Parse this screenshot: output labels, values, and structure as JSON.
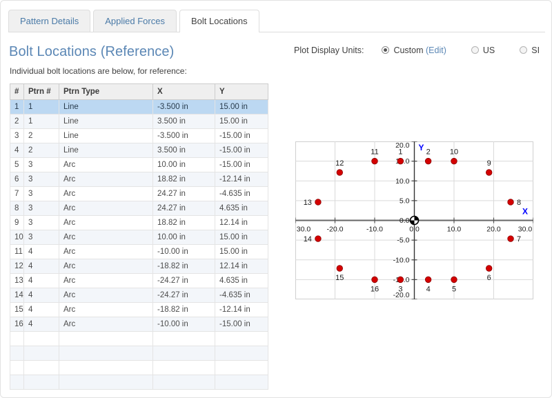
{
  "tabs": [
    {
      "label": "Pattern Details",
      "active": false
    },
    {
      "label": "Applied Forces",
      "active": false
    },
    {
      "label": "Bolt Locations",
      "active": true
    }
  ],
  "heading": "Bolt Locations (Reference)",
  "description": "Individual bolt locations are below, for reference:",
  "table": {
    "columns": [
      "#",
      "Ptrn #",
      "Ptrn Type",
      "X",
      "Y"
    ],
    "rows": [
      {
        "n": "1",
        "ptrn": "1",
        "type": "Line",
        "x": "-3.500 in",
        "y": "15.00 in",
        "selected": true
      },
      {
        "n": "2",
        "ptrn": "1",
        "type": "Line",
        "x": "3.500 in",
        "y": "15.00 in",
        "selected": false
      },
      {
        "n": "3",
        "ptrn": "2",
        "type": "Line",
        "x": "-3.500 in",
        "y": "-15.00 in",
        "selected": false
      },
      {
        "n": "4",
        "ptrn": "2",
        "type": "Line",
        "x": "3.500 in",
        "y": "-15.00 in",
        "selected": false
      },
      {
        "n": "5",
        "ptrn": "3",
        "type": "Arc",
        "x": "10.00 in",
        "y": "-15.00 in",
        "selected": false
      },
      {
        "n": "6",
        "ptrn": "3",
        "type": "Arc",
        "x": "18.82 in",
        "y": "-12.14 in",
        "selected": false
      },
      {
        "n": "7",
        "ptrn": "3",
        "type": "Arc",
        "x": "24.27 in",
        "y": "-4.635 in",
        "selected": false
      },
      {
        "n": "8",
        "ptrn": "3",
        "type": "Arc",
        "x": "24.27 in",
        "y": "4.635 in",
        "selected": false
      },
      {
        "n": "9",
        "ptrn": "3",
        "type": "Arc",
        "x": "18.82 in",
        "y": "12.14 in",
        "selected": false
      },
      {
        "n": "10",
        "ptrn": "3",
        "type": "Arc",
        "x": "10.00 in",
        "y": "15.00 in",
        "selected": false
      },
      {
        "n": "11",
        "ptrn": "4",
        "type": "Arc",
        "x": "-10.00 in",
        "y": "15.00 in",
        "selected": false
      },
      {
        "n": "12",
        "ptrn": "4",
        "type": "Arc",
        "x": "-18.82 in",
        "y": "12.14 in",
        "selected": false
      },
      {
        "n": "13",
        "ptrn": "4",
        "type": "Arc",
        "x": "-24.27 in",
        "y": "4.635 in",
        "selected": false
      },
      {
        "n": "14",
        "ptrn": "4",
        "type": "Arc",
        "x": "-24.27 in",
        "y": "-4.635 in",
        "selected": false
      },
      {
        "n": "15",
        "ptrn": "4",
        "type": "Arc",
        "x": "-18.82 in",
        "y": "-12.14 in",
        "selected": false
      },
      {
        "n": "16",
        "ptrn": "4",
        "type": "Arc",
        "x": "-10.00 in",
        "y": "-15.00 in",
        "selected": false
      }
    ],
    "empty_row_count": 4
  },
  "units": {
    "label": "Plot Display Units:",
    "options": [
      {
        "label": "Custom",
        "selected": true,
        "edit_label": "(Edit)"
      },
      {
        "label": "US",
        "selected": false
      },
      {
        "label": "SI",
        "selected": false
      }
    ]
  },
  "chart_data": {
    "type": "scatter",
    "title": "",
    "xlabel": "X",
    "ylabel": "Y",
    "xlim": [
      -30.0,
      30.0
    ],
    "ylim": [
      -20.0,
      20.0
    ],
    "xticks": [
      -30.0,
      -20.0,
      -10.0,
      0.0,
      10.0,
      20.0,
      30.0
    ],
    "xtick_labels": [
      "30.0",
      "-20.0",
      "-10.0",
      "0.0",
      "10.0",
      "20.0",
      "30.0"
    ],
    "yticks": [
      -20.0,
      -15.0,
      -10.0,
      -5.0,
      0.0,
      5.0,
      10.0,
      15.0,
      20.0
    ],
    "ytick_labels": [
      "-20.0",
      "-15.0",
      "-10.0",
      "-5.0",
      "0.0",
      "5.0",
      "10.0",
      "15.0",
      "20.0"
    ],
    "grid": true,
    "legend": false,
    "marker_color": "#d40000",
    "axis_label_color": "#0000ff",
    "origin_marker": "centroid",
    "points": [
      {
        "label": "1",
        "x": -3.5,
        "y": 15.0,
        "lpos": "above"
      },
      {
        "label": "2",
        "x": 3.5,
        "y": 15.0,
        "lpos": "above"
      },
      {
        "label": "3",
        "x": -3.5,
        "y": -15.0,
        "lpos": "below"
      },
      {
        "label": "4",
        "x": 3.5,
        "y": -15.0,
        "lpos": "below"
      },
      {
        "label": "5",
        "x": 10.0,
        "y": -15.0,
        "lpos": "below"
      },
      {
        "label": "6",
        "x": 18.82,
        "y": -12.14,
        "lpos": "below"
      },
      {
        "label": "7",
        "x": 24.27,
        "y": -4.635,
        "lpos": "right"
      },
      {
        "label": "8",
        "x": 24.27,
        "y": 4.635,
        "lpos": "right"
      },
      {
        "label": "9",
        "x": 18.82,
        "y": 12.14,
        "lpos": "above"
      },
      {
        "label": "10",
        "x": 10.0,
        "y": 15.0,
        "lpos": "above"
      },
      {
        "label": "11",
        "x": -10.0,
        "y": 15.0,
        "lpos": "above"
      },
      {
        "label": "12",
        "x": -18.82,
        "y": 12.14,
        "lpos": "above"
      },
      {
        "label": "13",
        "x": -24.27,
        "y": 4.635,
        "lpos": "left"
      },
      {
        "label": "14",
        "x": -24.27,
        "y": -4.635,
        "lpos": "left"
      },
      {
        "label": "15",
        "x": -18.82,
        "y": -12.14,
        "lpos": "below"
      },
      {
        "label": "16",
        "x": -10.0,
        "y": -15.0,
        "lpos": "below"
      }
    ]
  }
}
